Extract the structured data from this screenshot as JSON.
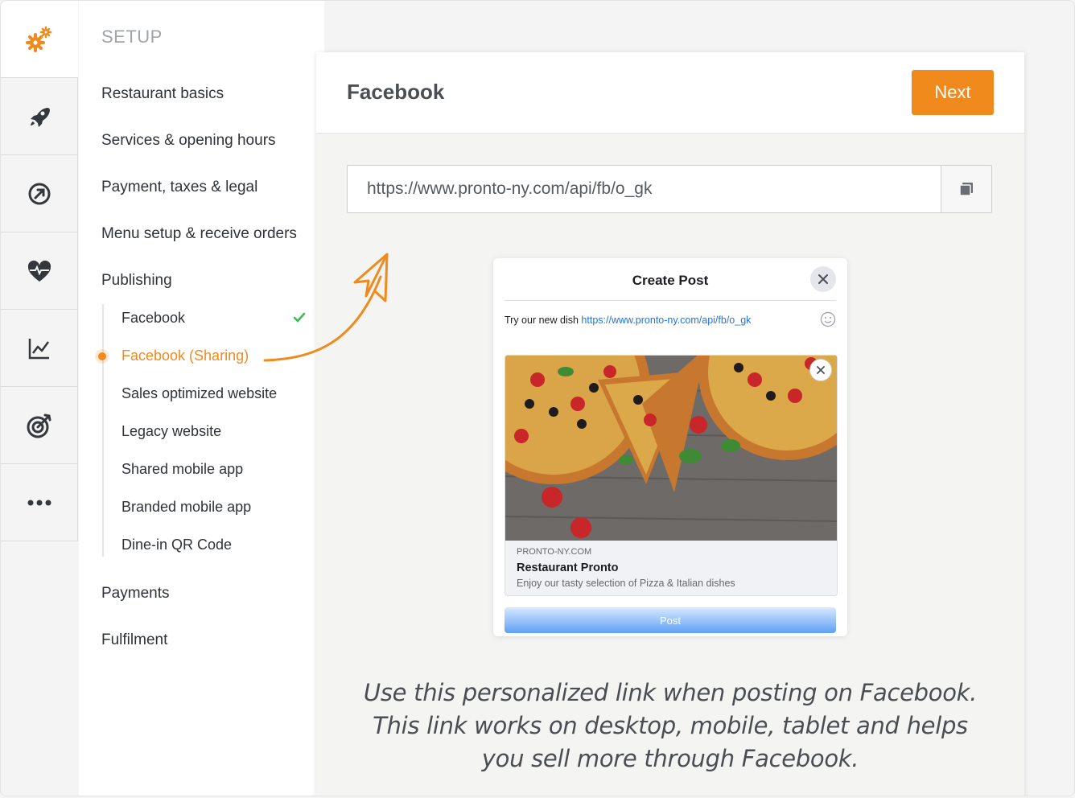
{
  "rail": {
    "items": [
      "gears-icon",
      "rocket-icon",
      "dashboard-icon",
      "heart-pulse-icon",
      "chart-icon",
      "target-icon",
      "more-icon"
    ],
    "accent_color": "#f08a1c"
  },
  "nav": {
    "heading": "SETUP",
    "items": [
      "Restaurant basics",
      "Services & opening hours",
      "Payment, taxes & legal",
      "Menu setup & receive orders",
      "Publishing"
    ],
    "publishing_items": [
      "Facebook",
      "Facebook (Sharing)",
      "Sales optimized website",
      "Legacy website",
      "Shared mobile app",
      "Branded mobile app",
      "Dine-in QR Code"
    ],
    "active_item": "Facebook (Sharing)",
    "after_items": [
      "Payments",
      "Fulfilment"
    ]
  },
  "main": {
    "title": "Facebook",
    "next_label": "Next",
    "url": "https://www.pronto-ny.com/api/fb/o_gk",
    "caption": "Use this personalized link when posting on Facebook. This link works on desktop, mobile, tablet and helps you sell more through Facebook."
  },
  "preview": {
    "title": "Create Post",
    "message_prefix": "Try our new dish",
    "message_link": "https://www.pronto-ny.com/api/fb/o_gk",
    "domain": "PRONTO-NY.COM",
    "name": "Restaurant Pronto",
    "description": "Enjoy our tasty selection of Pizza & Italian dishes",
    "post_label": "Post"
  }
}
